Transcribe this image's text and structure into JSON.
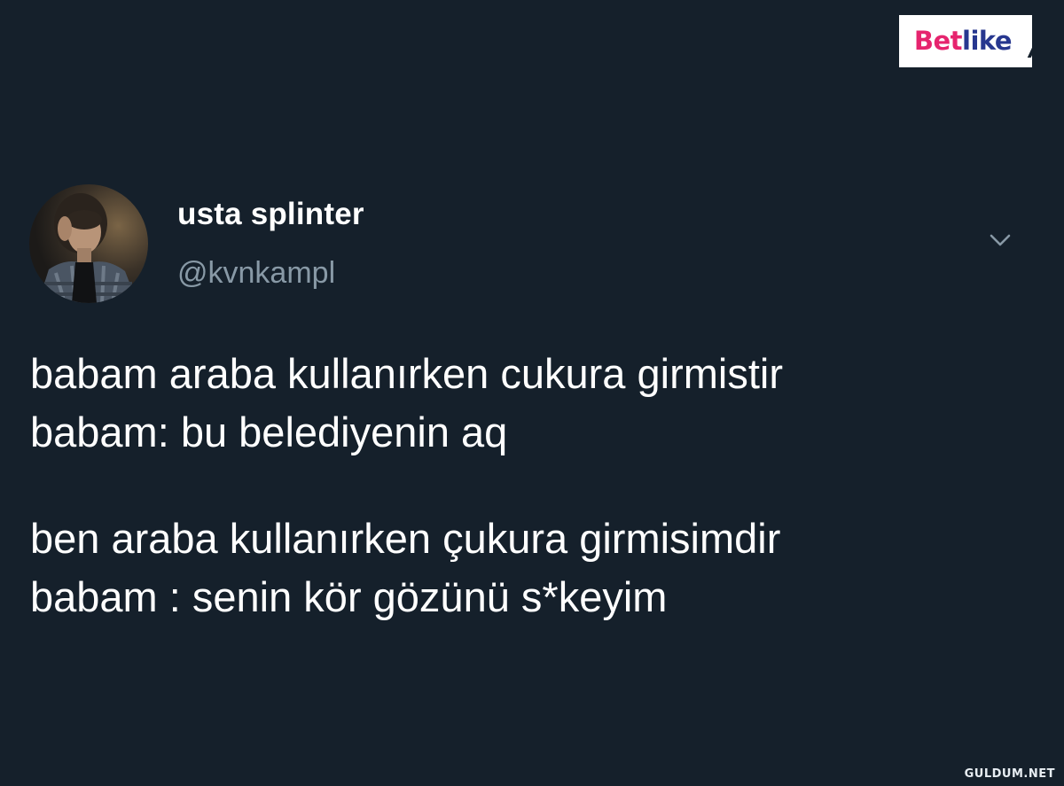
{
  "brand_logo": {
    "text_a": "Bet",
    "text_b": "like",
    "color_a": "#e6246e",
    "color_b": "#27378f"
  },
  "tweet": {
    "author": {
      "display_name": "usta splinter",
      "handle": "@kvnkampl"
    },
    "menu_icon": "chevron-down-icon",
    "lines": [
      "babam araba kullanırken cukura girmistir",
      "babam: bu belediyenin aq",
      "ben araba kullanırken çukura girmisimdir",
      "babam : senin kör gözünü s*keyim"
    ]
  },
  "footer_watermark": "GULDUM.NET",
  "colors": {
    "background": "#15202b",
    "primary_text": "#ffffff",
    "secondary_text": "#8899a6"
  }
}
